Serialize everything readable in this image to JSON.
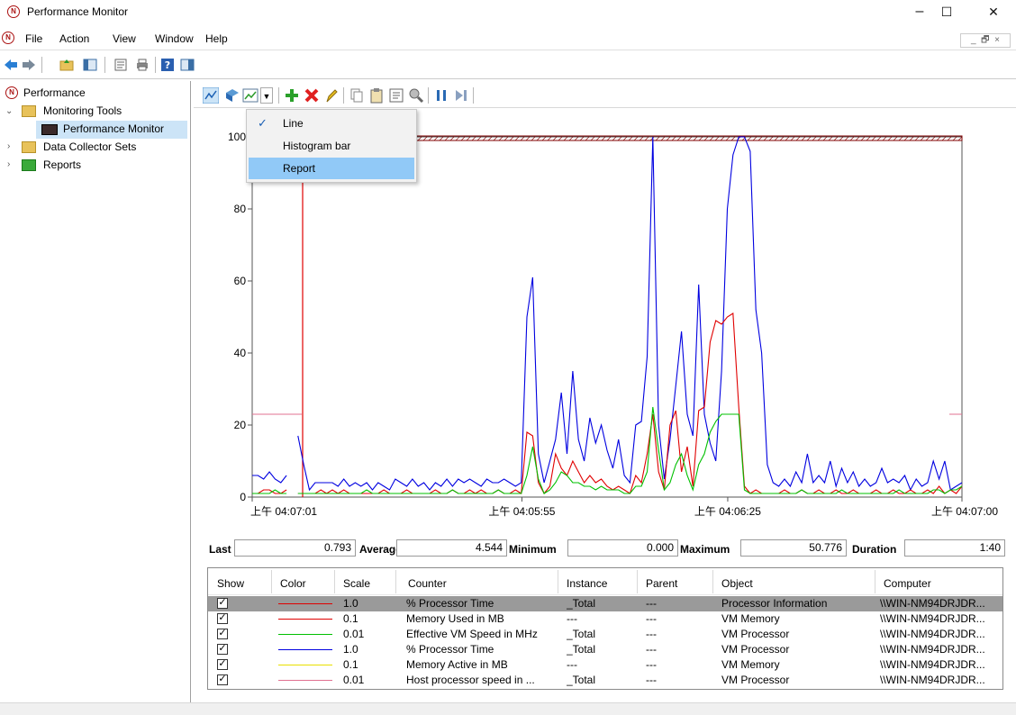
{
  "window": {
    "title": "Performance Monitor",
    "min": "–",
    "max": "☐",
    "close": "✕"
  },
  "menu": [
    "File",
    "Action",
    "View",
    "Window",
    "Help"
  ],
  "tree": {
    "root": "Performance",
    "monitoring_tools": "Monitoring Tools",
    "performance_monitor": "Performance Monitor",
    "data_collector_sets": "Data Collector Sets",
    "reports": "Reports"
  },
  "dropdown": {
    "items": [
      "Line",
      "Histogram bar",
      "Report"
    ],
    "checked": "Line",
    "highlighted": "Report"
  },
  "chart_data": {
    "type": "line",
    "ylim": [
      0,
      100
    ],
    "yticks": [
      "0",
      "20",
      "40",
      "60",
      "80",
      "100"
    ],
    "xticks": [
      "上午 04:07:01",
      "上午 04:05:55",
      "上午 04:06:25",
      "上午 04:07:00"
    ],
    "colors": {
      "red": "#e00000",
      "green": "#00c000",
      "blue": "#0000e0",
      "pink": "#e07090",
      "maroon": "#800000"
    },
    "series": [
      {
        "color": "#0000e0",
        "values": [
          6,
          6,
          5,
          7,
          5,
          4,
          6,
          null,
          17,
          9,
          2,
          4,
          4,
          4,
          4,
          3,
          5,
          3,
          4,
          3,
          4,
          2,
          4,
          3,
          2,
          5,
          4,
          3,
          5,
          3,
          4,
          2,
          4,
          3,
          5,
          3,
          5,
          4,
          5,
          4,
          3,
          5,
          4,
          4,
          5,
          4,
          3,
          4,
          50,
          61,
          12,
          4,
          10,
          16,
          29,
          12,
          35,
          16,
          10,
          22,
          15,
          20,
          13,
          8,
          16,
          6,
          4,
          20,
          21,
          39,
          101,
          20,
          5,
          16,
          31,
          46,
          23,
          17,
          59,
          23,
          15,
          10,
          35,
          80,
          95,
          101,
          101,
          96,
          52,
          40,
          9,
          4,
          3,
          5,
          3,
          7,
          4,
          12,
          4,
          6,
          4,
          10,
          3,
          8,
          4,
          7,
          3,
          5,
          3,
          4,
          8,
          4,
          5,
          4,
          6,
          2,
          5,
          3,
          4,
          10,
          5,
          10,
          2,
          3,
          4
        ]
      },
      {
        "color": "#e00000",
        "values": [
          1,
          1,
          2,
          2,
          1,
          1,
          2,
          null,
          1,
          1,
          1,
          1,
          2,
          1,
          2,
          1,
          2,
          1,
          1,
          1,
          1,
          1,
          1,
          2,
          1,
          1,
          1,
          2,
          1,
          1,
          1,
          1,
          2,
          1,
          1,
          2,
          1,
          1,
          2,
          1,
          2,
          1,
          1,
          2,
          1,
          1,
          2,
          1,
          18,
          17,
          4,
          1,
          3,
          12,
          8,
          6,
          10,
          7,
          4,
          6,
          4,
          5,
          3,
          2,
          3,
          2,
          1,
          6,
          4,
          12,
          23,
          7,
          2,
          20,
          24,
          7,
          14,
          3,
          24,
          25,
          43,
          49,
          48,
          50,
          51,
          25,
          3,
          1,
          2,
          1,
          1,
          1,
          1,
          2,
          1,
          1,
          2,
          1,
          1,
          2,
          1,
          1,
          2,
          1,
          1,
          2,
          1,
          1,
          1,
          2,
          1,
          1,
          2,
          1,
          1,
          2,
          1,
          1,
          2,
          1,
          3,
          1,
          2,
          1,
          3
        ]
      },
      {
        "color": "#00c000",
        "values": [
          1,
          1,
          1,
          1,
          2,
          1,
          1,
          null,
          1,
          1,
          1,
          1,
          1,
          1,
          1,
          1,
          1,
          1,
          1,
          1,
          2,
          1,
          1,
          1,
          1,
          1,
          1,
          1,
          1,
          1,
          1,
          1,
          1,
          1,
          1,
          2,
          1,
          1,
          1,
          1,
          1,
          1,
          1,
          2,
          1,
          1,
          1,
          1,
          6,
          14,
          5,
          1,
          2,
          4,
          7,
          6,
          4,
          4,
          3,
          3,
          2,
          3,
          2,
          2,
          2,
          1,
          1,
          3,
          3,
          7,
          25,
          13,
          2,
          4,
          9,
          12,
          6,
          2,
          9,
          12,
          18,
          21,
          23,
          23,
          23,
          23,
          2,
          1,
          1,
          1,
          1,
          1,
          1,
          1,
          1,
          1,
          2,
          1,
          1,
          1,
          1,
          1,
          1,
          2,
          1,
          1,
          1,
          1,
          1,
          1,
          1,
          1,
          1,
          2,
          1,
          1,
          1,
          1,
          1,
          2,
          2,
          1,
          2,
          2,
          3
        ]
      }
    ]
  },
  "stats": {
    "last_label": "Last",
    "last": "0.793",
    "average_label": "Average",
    "average": "4.544",
    "minimum_label": "Minimum",
    "minimum": "0.000",
    "maximum_label": "Maximum",
    "maximum": "50.776",
    "duration_label": "Duration",
    "duration": "1:40"
  },
  "legend": {
    "headers": [
      "Show",
      "Color",
      "Scale",
      "Counter",
      "Instance",
      "Parent",
      "Object",
      "Computer"
    ],
    "rows": [
      {
        "color": "#e00000",
        "scale": "1.0",
        "counter": "% Processor Time",
        "instance": "_Total",
        "parent": "---",
        "object": "Processor Information",
        "computer": "\\\\WIN-NM94DRJDR..."
      },
      {
        "color": "#e00000",
        "scale": "0.1",
        "counter": "Memory Used in MB",
        "instance": "---",
        "parent": "---",
        "object": "VM Memory",
        "computer": "\\\\WIN-NM94DRJDR..."
      },
      {
        "color": "#00c000",
        "scale": "0.01",
        "counter": "Effective VM Speed in MHz",
        "instance": "_Total",
        "parent": "---",
        "object": "VM Processor",
        "computer": "\\\\WIN-NM94DRJDR..."
      },
      {
        "color": "#0000e0",
        "scale": "1.0",
        "counter": "% Processor Time",
        "instance": "_Total",
        "parent": "---",
        "object": "VM Processor",
        "computer": "\\\\WIN-NM94DRJDR..."
      },
      {
        "color": "#e8e000",
        "scale": "0.1",
        "counter": "Memory Active in MB",
        "instance": "---",
        "parent": "---",
        "object": "VM Memory",
        "computer": "\\\\WIN-NM94DRJDR..."
      },
      {
        "color": "#e07090",
        "scale": "0.01",
        "counter": "Host processor speed in ...",
        "instance": "_Total",
        "parent": "---",
        "object": "VM Processor",
        "computer": "\\\\WIN-NM94DRJDR..."
      }
    ]
  }
}
